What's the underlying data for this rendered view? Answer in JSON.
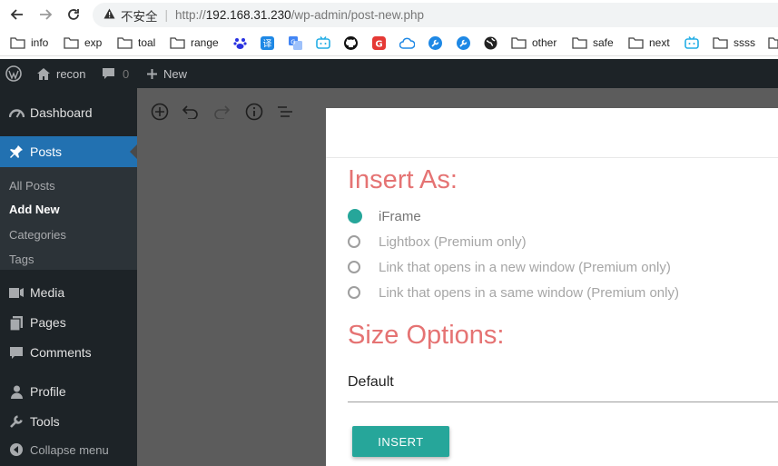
{
  "browser": {
    "security_label": "不安全",
    "url_scheme": "http://",
    "url_host": "192.168.31.230",
    "url_path": "/wp-admin/post-new.php"
  },
  "bookmarks": [
    {
      "label": "info",
      "icon": "folder-icon"
    },
    {
      "label": "exp",
      "icon": "folder-icon"
    },
    {
      "label": "toal",
      "icon": "folder-icon"
    },
    {
      "label": "range",
      "icon": "folder-icon"
    },
    {
      "label": "",
      "icon": "baidu-paw-icon"
    },
    {
      "label": "",
      "icon": "translate-icon"
    },
    {
      "label": "",
      "icon": "google-translate-icon"
    },
    {
      "label": "",
      "icon": "bilibili-icon"
    },
    {
      "label": "",
      "icon": "github-icon"
    },
    {
      "label": "",
      "icon": "red-g-icon"
    },
    {
      "label": "",
      "icon": "cloud-icon"
    },
    {
      "label": "",
      "icon": "wrench-icon"
    },
    {
      "label": "",
      "icon": "wrench-icon"
    },
    {
      "label": "",
      "icon": "globe-icon"
    },
    {
      "label": "other",
      "icon": "folder-icon"
    },
    {
      "label": "safe",
      "icon": "folder-icon"
    },
    {
      "label": "next",
      "icon": "folder-icon"
    },
    {
      "label": "",
      "icon": "bilibili-icon"
    },
    {
      "label": "ssss",
      "icon": "folder-icon"
    }
  ],
  "adminbar": {
    "site_name": "recon",
    "comments_count": "0",
    "new_label": "New"
  },
  "sidebar": {
    "dashboard": "Dashboard",
    "posts": "Posts",
    "sub": [
      "All Posts",
      "Add New",
      "Categories",
      "Tags"
    ],
    "media": "Media",
    "pages": "Pages",
    "comments": "Comments",
    "profile": "Profile",
    "tools": "Tools",
    "collapse": "Collapse menu"
  },
  "modal": {
    "insert_as_title": "Insert As:",
    "options": [
      {
        "label": "iFrame",
        "checked": true
      },
      {
        "label": "Lightbox (Premium only)",
        "checked": false
      },
      {
        "label": "Link that opens in a new window (Premium only)",
        "checked": false
      },
      {
        "label": "Link that opens in a same window (Premium only)",
        "checked": false
      }
    ],
    "size_title": "Size Options:",
    "size_value": "Default",
    "insert_button": "INSERT"
  },
  "colors": {
    "accent": "#26a69a",
    "heading": "#e57373",
    "wp_dark": "#1d2327",
    "wp_blue": "#2271b1"
  }
}
